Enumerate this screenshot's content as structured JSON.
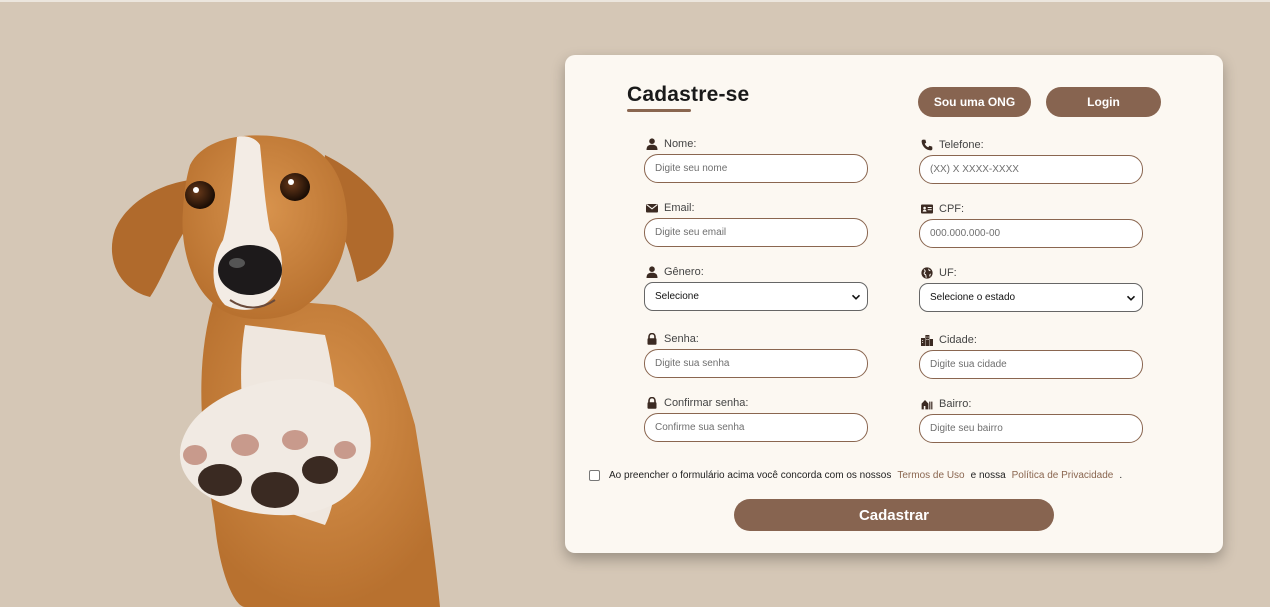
{
  "colors": {
    "background": "#d5c7b6",
    "card": "#fcf8f2",
    "accent": "#876450",
    "link": "#8a6650"
  },
  "hero": {
    "image": "dog-photo"
  },
  "form": {
    "title": "Cadastre-se",
    "buttons": {
      "ong": "Sou uma ONG",
      "login": "Login"
    },
    "fields": {
      "nome": {
        "label": "Nome:",
        "placeholder": "Digite seu nome",
        "icon": "user-icon"
      },
      "telefone": {
        "label": "Telefone:",
        "placeholder": "(XX) X XXXX-XXXX",
        "icon": "phone-icon"
      },
      "email": {
        "label": "Email:",
        "placeholder": "Digite seu email",
        "icon": "envelope-icon"
      },
      "cpf": {
        "label": "CPF:",
        "placeholder": "000.000.000-00",
        "icon": "id-card-icon"
      },
      "genero": {
        "label": "Gênero:",
        "value": "Selecione",
        "icon": "user-icon"
      },
      "uf": {
        "label": "UF:",
        "value": "Selecione o estado",
        "icon": "globe-icon"
      },
      "senha": {
        "label": "Senha:",
        "placeholder": "Digite sua senha",
        "icon": "lock-icon"
      },
      "cidade": {
        "label": "Cidade:",
        "placeholder": "Digite sua cidade",
        "icon": "city-icon"
      },
      "confirmar": {
        "label": "Confirmar senha:",
        "placeholder": "Confirme sua senha",
        "icon": "lock-icon"
      },
      "bairro": {
        "label": "Bairro:",
        "placeholder": "Digite seu bairro",
        "icon": "house-icon"
      }
    },
    "terms": {
      "text_before": "Ao preencher o formulário acima você concorda com os nossos",
      "terms_link": "Termos de Uso",
      "text_middle": "e nossa",
      "privacy_link": "Política de Privacidade",
      "text_end": "."
    },
    "submit": "Cadastrar"
  }
}
